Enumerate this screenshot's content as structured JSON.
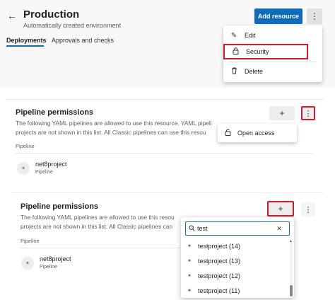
{
  "header": {
    "title": "Production",
    "subtitle": "Automatically created environment",
    "add_resource_label": "Add resource",
    "back_icon": "arrow-left-icon",
    "more_icon": "more-vertical-icon"
  },
  "tabs": [
    {
      "label": "Deployments",
      "active": true
    },
    {
      "label": "Approvals and checks",
      "active": false
    }
  ],
  "environment_menu": {
    "items": [
      {
        "label": "Edit",
        "icon": "pencil-icon"
      },
      {
        "label": "Security",
        "icon": "lock-icon"
      },
      {
        "label": "Delete",
        "icon": "trash-icon"
      }
    ]
  },
  "panel_a": {
    "title": "Pipeline permissions",
    "desc_line1": "The following YAML pipelines are allowed to use this resource. YAML pipeli",
    "desc_line2": "projects are not shown in this list. All Classic pipelines can use this resou",
    "section_label": "Pipeline",
    "menu_item": {
      "label": "Open access",
      "icon": "unlock-icon"
    },
    "pipeline": {
      "name": "net8project",
      "type": "Pipeline"
    }
  },
  "panel_b": {
    "title": "Pipeline permissions",
    "desc_line1": "The following YAML pipelines are allowed to use this resou",
    "desc_line2": "projects are not shown in this list. All Classic pipelines can",
    "section_label": "Pipeline",
    "pipeline": {
      "name": "net8project",
      "type": "Pipeline"
    },
    "search": {
      "value": "test"
    },
    "results": [
      {
        "label": "testproject (14)"
      },
      {
        "label": "testproject (13)"
      },
      {
        "label": "testproject (12)"
      },
      {
        "label": "testproject (11)"
      }
    ]
  },
  "colors": {
    "accent": "#0f6cbd",
    "highlight_box": "#d11a2a"
  }
}
